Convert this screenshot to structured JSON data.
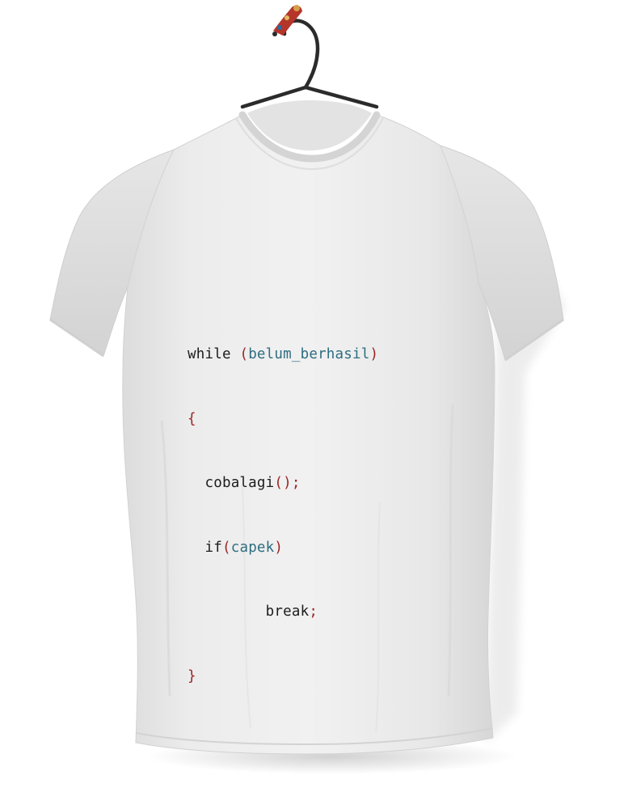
{
  "colors": {
    "background": "#ffffff",
    "shirt": "#e9e9e9",
    "keyword": "#1c1c1c",
    "punctuation": "#9b2423",
    "identifier": "#2e6d80",
    "hanger": "#2b2b2b",
    "hanger_tag": "#b5352b"
  },
  "code": {
    "line1": {
      "keyword": "while",
      "open_paren": "(",
      "condition": "belum_berhasil",
      "close_paren": ")"
    },
    "line2": {
      "open_brace": "{"
    },
    "line3": {
      "call": "cobalagi",
      "parens": "()",
      "semicolon": ";"
    },
    "line4": {
      "keyword": "if",
      "open_paren": "(",
      "condition": "capek",
      "close_paren": ")"
    },
    "line5": {
      "keyword": "break",
      "semicolon": ";"
    },
    "line6": {
      "close_brace": "}"
    }
  }
}
